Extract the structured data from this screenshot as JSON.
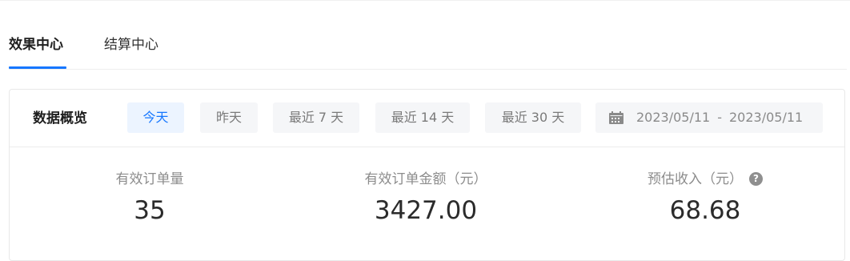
{
  "tabs": [
    {
      "label": "效果中心",
      "active": true
    },
    {
      "label": "结算中心",
      "active": false
    }
  ],
  "overview": {
    "title": "数据概览",
    "ranges": [
      {
        "label": "今天",
        "active": true
      },
      {
        "label": "昨天",
        "active": false
      },
      {
        "label": "最近 7 天",
        "active": false
      },
      {
        "label": "最近 14 天",
        "active": false
      },
      {
        "label": "最近 30 天",
        "active": false
      }
    ],
    "date_range": {
      "icon": "calendar-icon",
      "start": "2023/05/11",
      "separator": "-",
      "end": "2023/05/11"
    }
  },
  "metrics": [
    {
      "label": "有效订单量",
      "value": "35"
    },
    {
      "label": "有效订单金额（元）",
      "value": "3427.00"
    },
    {
      "label": "预估收入（元）",
      "value": "68.68",
      "help_icon": "question-circle-icon"
    }
  ],
  "colors": {
    "accent": "#1677ff",
    "active_range_bg": "#ecf4ff",
    "button_bg": "#f5f6f8"
  }
}
